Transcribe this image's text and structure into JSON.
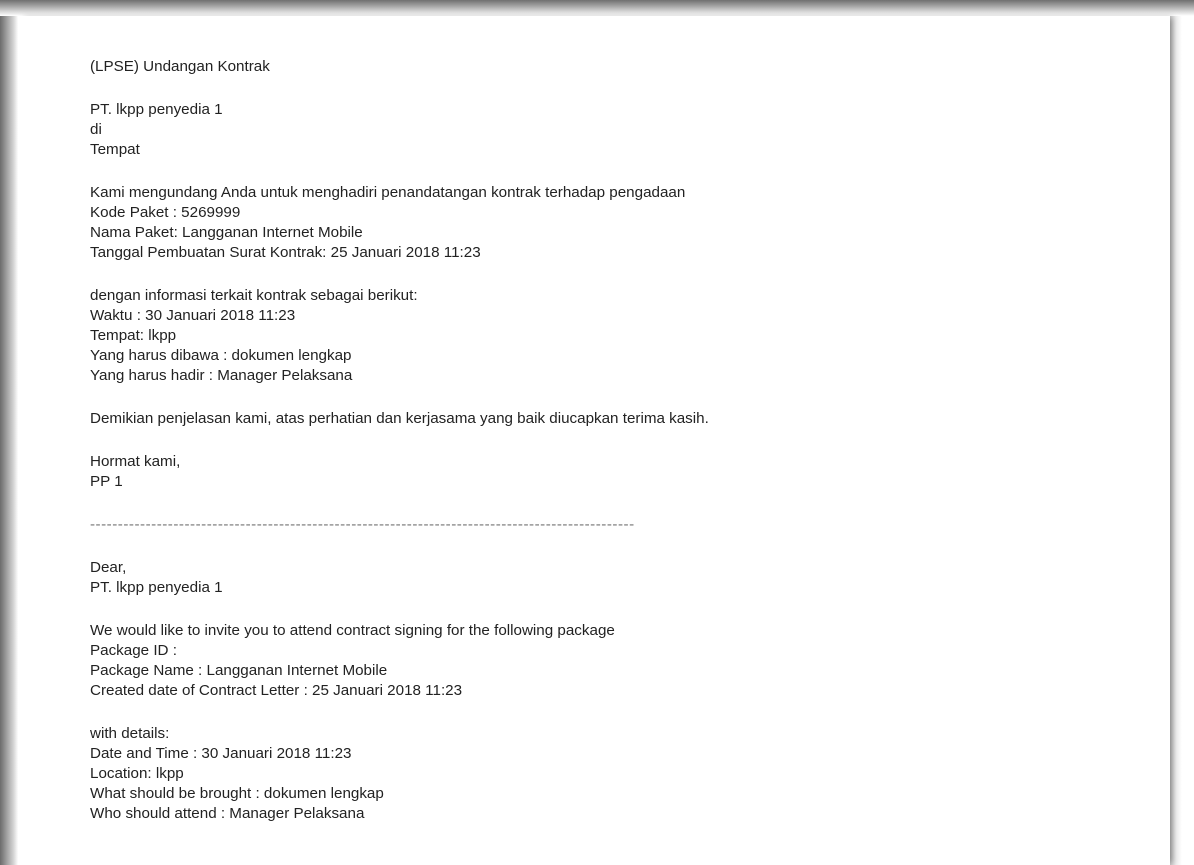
{
  "email": {
    "subject": "(LPSE) Undangan Kontrak",
    "id_recipient": [
      "PT. lkpp penyedia 1",
      "di",
      "Tempat"
    ],
    "id_intro": [
      "Kami mengundang Anda untuk menghadiri penandatangan kontrak terhadap pengadaan",
      "Kode Paket : 5269999",
      "Nama Paket: Langganan Internet Mobile",
      "Tanggal Pembuatan Surat Kontrak: 25 Januari 2018 11:23"
    ],
    "id_details": [
      "dengan informasi terkait kontrak sebagai berikut:",
      "Waktu : 30 Januari 2018 11:23",
      "Tempat: lkpp",
      "Yang harus dibawa : dokumen lengkap",
      "Yang harus hadir : Manager Pelaksana"
    ],
    "id_closing": "Demikian penjelasan kami, atas perhatian dan kerjasama yang baik diucapkan terima kasih.",
    "id_signature": [
      "Hormat kami,",
      "PP 1"
    ],
    "separator": "--------------------------------------------------------------------------------------------------",
    "en_recipient": [
      "Dear,",
      "PT. lkpp penyedia 1"
    ],
    "en_intro": [
      "We would like to invite you to attend contract signing for the following package",
      "Package ID :",
      "Package Name : Langganan Internet Mobile",
      "Created date of Contract Letter : 25 Januari 2018 11:23"
    ],
    "en_details": [
      "with details:",
      "Date and Time : 30 Januari 2018 11:23",
      "Location: lkpp",
      "What should be brought : dokumen lengkap",
      "Who should attend : Manager Pelaksana"
    ]
  }
}
